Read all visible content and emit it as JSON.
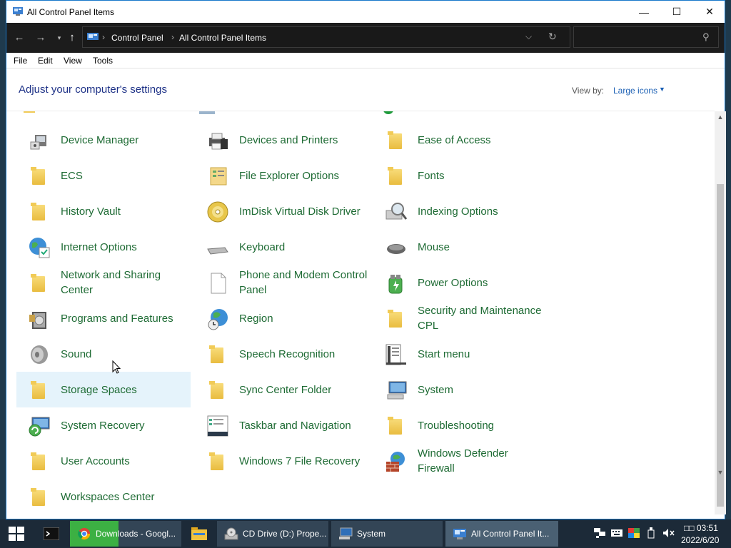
{
  "window": {
    "title": "All Control Panel Items",
    "controls": {
      "minimize": "—",
      "maximize": "☐",
      "close": "✕"
    }
  },
  "address_bar": {
    "breadcrumbs": [
      "Control Panel",
      "All Control Panel Items"
    ],
    "separator": "›",
    "search_placeholder": ""
  },
  "menu": [
    "File",
    "Edit",
    "View",
    "Tools"
  ],
  "header": {
    "title": "Adjust your computer's settings",
    "view_by_label": "View by:",
    "view_by_value": "Large icons"
  },
  "items": [
    {
      "label": "Device Manager",
      "icon": "device-manager-icon"
    },
    {
      "label": "Devices and Printers",
      "icon": "printer-icon"
    },
    {
      "label": "Ease of Access",
      "icon": "folder-icon"
    },
    {
      "label": "ECS",
      "icon": "folder-icon"
    },
    {
      "label": "File Explorer Options",
      "icon": "folder-options-icon"
    },
    {
      "label": "Fonts",
      "icon": "folder-icon"
    },
    {
      "label": "History Vault",
      "icon": "folder-icon"
    },
    {
      "label": "ImDisk Virtual Disk Driver",
      "icon": "disk-icon"
    },
    {
      "label": "Indexing Options",
      "icon": "indexing-icon"
    },
    {
      "label": "Internet Options",
      "icon": "globe-icon"
    },
    {
      "label": "Keyboard",
      "icon": "keyboard-icon"
    },
    {
      "label": "Mouse",
      "icon": "mouse-icon"
    },
    {
      "label": "Network and Sharing Center",
      "icon": "folder-icon"
    },
    {
      "label": "Phone and Modem Control Panel",
      "icon": "document-icon"
    },
    {
      "label": "Power Options",
      "icon": "power-icon"
    },
    {
      "label": "Programs and Features",
      "icon": "programs-icon"
    },
    {
      "label": "Region",
      "icon": "region-icon"
    },
    {
      "label": "Security and Maintenance CPL",
      "icon": "folder-icon"
    },
    {
      "label": "Sound",
      "icon": "speaker-icon"
    },
    {
      "label": "Speech Recognition",
      "icon": "folder-icon"
    },
    {
      "label": "Start menu",
      "icon": "start-menu-icon"
    },
    {
      "label": "Storage Spaces",
      "icon": "folder-icon"
    },
    {
      "label": "Sync Center Folder",
      "icon": "folder-icon"
    },
    {
      "label": "System",
      "icon": "system-icon"
    },
    {
      "label": "System Recovery",
      "icon": "recovery-icon"
    },
    {
      "label": "Taskbar and Navigation",
      "icon": "taskbar-icon"
    },
    {
      "label": "Troubleshooting",
      "icon": "folder-icon"
    },
    {
      "label": "User Accounts",
      "icon": "folder-icon"
    },
    {
      "label": "Windows 7 File Recovery",
      "icon": "folder-icon"
    },
    {
      "label": "Windows Defender Firewall",
      "icon": "firewall-icon"
    },
    {
      "label": "Workspaces Center",
      "icon": "folder-icon"
    }
  ],
  "taskbar": {
    "tasks": [
      {
        "label": "Downloads - Googl...",
        "icon": "chrome-icon"
      },
      {
        "label": "CD Drive (D:) Prope...",
        "icon": "cd-drive-icon"
      },
      {
        "label": "System",
        "icon": "system-icon"
      },
      {
        "label": "All Control Panel It...",
        "icon": "control-panel-icon"
      }
    ],
    "clock_time": "03:51",
    "clock_prefix": "□□",
    "clock_date": "2022/6/20"
  },
  "colors": {
    "link_green": "#1e6b34",
    "heading_blue": "#1e3287",
    "hover_bg": "#e5f3fb",
    "taskbar": "#1c2a38"
  }
}
